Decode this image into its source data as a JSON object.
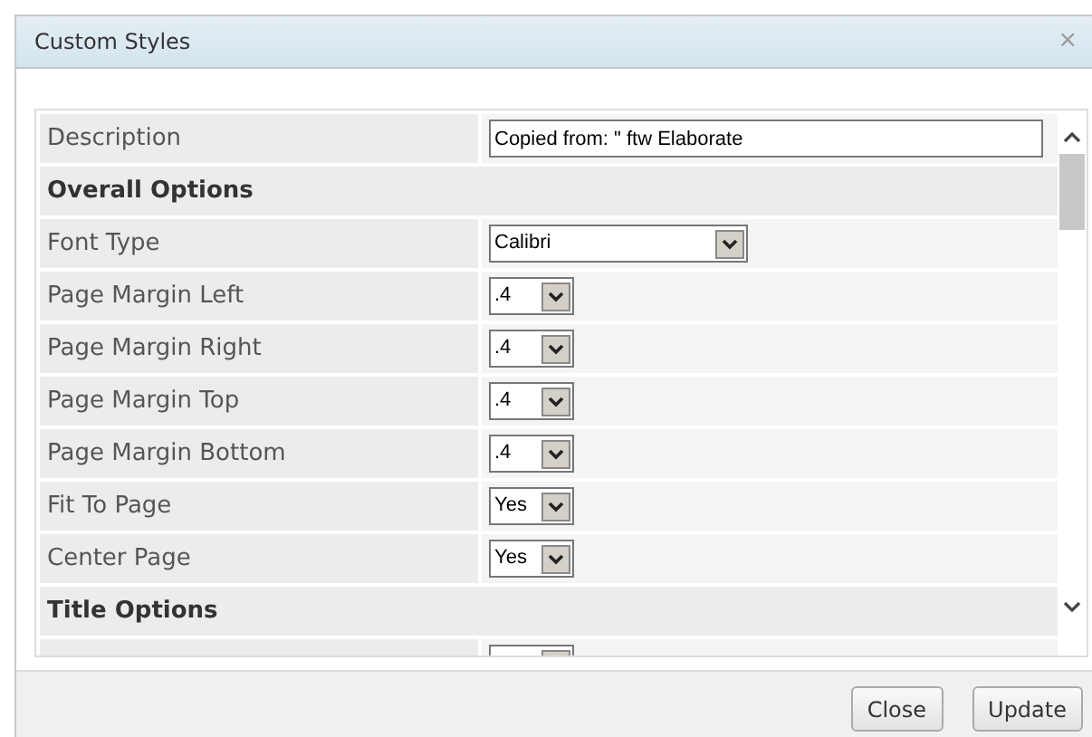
{
  "window": {
    "title": "Custom Styles",
    "close": "×"
  },
  "rows": [
    {
      "kind": "text",
      "label": "Description",
      "value": "Copied from: \" ftw Elaborate"
    },
    {
      "kind": "section",
      "label": "Overall Options"
    },
    {
      "kind": "wide_select",
      "label": "Font Type",
      "value": "Calibri"
    },
    {
      "kind": "select",
      "label": "Page Margin Left",
      "value": ".4"
    },
    {
      "kind": "select",
      "label": "Page Margin Right",
      "value": ".4"
    },
    {
      "kind": "select",
      "label": "Page Margin Top",
      "value": ".4"
    },
    {
      "kind": "select",
      "label": "Page Margin Bottom",
      "value": ".4"
    },
    {
      "kind": "select",
      "label": "Fit To Page",
      "value": "Yes"
    },
    {
      "kind": "select",
      "label": "Center Page",
      "value": "Yes"
    },
    {
      "kind": "section",
      "label": "Title Options"
    },
    {
      "kind": "select"
    }
  ],
  "buttons": [
    "Close",
    "Update"
  ]
}
